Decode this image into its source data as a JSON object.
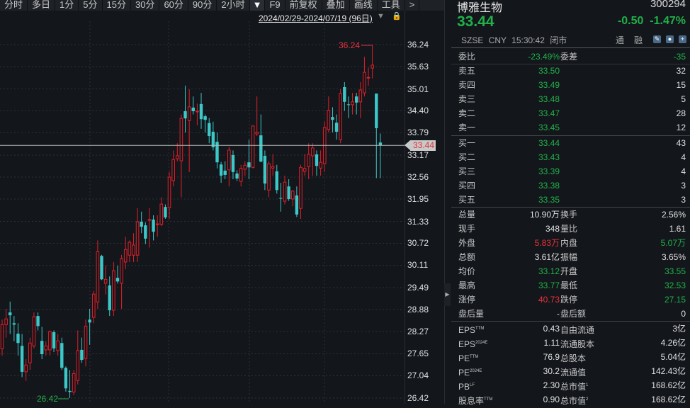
{
  "toolbar": {
    "items": [
      "分时",
      "多日",
      "1分",
      "5分",
      "15分",
      "30分",
      "60分",
      "90分",
      "2小时",
      "▼",
      "F9",
      "前复权",
      "叠加",
      "画线",
      "工具",
      ">"
    ]
  },
  "range": {
    "label": "2024/02/29-2024/07/19 (96日)"
  },
  "icons": {
    "range_dropdown": "triangle-down-icon",
    "lock": "lock-icon",
    "toggle": "chevron-right-icon"
  },
  "colors": {
    "up": "#e0202a",
    "down": "#3cc8c8",
    "green": "#22b04a",
    "red": "#e8323c",
    "bg": "#13161b"
  },
  "stock": {
    "name": "博雅生物",
    "code": "300294",
    "last": "33.44",
    "change": "-0.50",
    "change_pct": "-1.47%",
    "exchange": "SZSE",
    "currency": "CNY",
    "time": "15:30:42",
    "status": "闭市",
    "flag1": "通",
    "flag2": "融"
  },
  "weibi": {
    "label": "委比",
    "value": "-23.49%",
    "label2": "委差",
    "value2": "-35"
  },
  "asks": [
    {
      "label": "卖五",
      "price": "33.50",
      "vol": "32"
    },
    {
      "label": "卖四",
      "price": "33.49",
      "vol": "15"
    },
    {
      "label": "卖三",
      "price": "33.48",
      "vol": "5"
    },
    {
      "label": "卖二",
      "price": "33.47",
      "vol": "28"
    },
    {
      "label": "卖一",
      "price": "33.45",
      "vol": "12"
    }
  ],
  "bids": [
    {
      "label": "买一",
      "price": "33.44",
      "vol": "43"
    },
    {
      "label": "买二",
      "price": "33.43",
      "vol": "4"
    },
    {
      "label": "买三",
      "price": "33.39",
      "vol": "4"
    },
    {
      "label": "买四",
      "price": "33.38",
      "vol": "3"
    },
    {
      "label": "买五",
      "price": "33.35",
      "vol": "3"
    }
  ],
  "stats": [
    {
      "l": "总量",
      "v": "10.90万",
      "l2": "换手",
      "v2": "2.56%",
      "c1": "w",
      "c2": "w"
    },
    {
      "l": "现手",
      "v": "348",
      "l2": "量比",
      "v2": "1.61",
      "c1": "w",
      "c2": "w"
    },
    {
      "l": "外盘",
      "v": "5.83万",
      "l2": "内盘",
      "v2": "5.07万",
      "c1": "r",
      "c2": "g"
    },
    {
      "l": "总额",
      "v": "3.61亿",
      "l2": "振幅",
      "v2": "3.65%",
      "c1": "w",
      "c2": "w"
    },
    {
      "l": "均价",
      "v": "33.12",
      "l2": "开盘",
      "v2": "33.55",
      "c1": "g",
      "c2": "g"
    },
    {
      "l": "最高",
      "v": "33.77",
      "l2": "最低",
      "v2": "32.53",
      "c1": "g",
      "c2": "g"
    },
    {
      "l": "涨停",
      "v": "40.73",
      "l2": "跌停",
      "v2": "27.15",
      "c1": "r",
      "c2": "g"
    },
    {
      "l": "盘后量",
      "v": "-",
      "l2": "盘后额",
      "v2": "0",
      "c1": "w",
      "c2": "w"
    }
  ],
  "fundamentals": [
    {
      "l": "EPS",
      "sup": "TTM",
      "v": "0.43",
      "l2": "自由流通",
      "sup2": "",
      "v2": "3亿"
    },
    {
      "l": "EPS",
      "sup": "2024E",
      "v": "1.11",
      "l2": "流通股本",
      "sup2": "",
      "v2": "4.26亿"
    },
    {
      "l": "PE",
      "sup": "TTM",
      "v": "76.9",
      "l2": "总股本",
      "sup2": "",
      "v2": "5.04亿"
    },
    {
      "l": "PE",
      "sup": "2024E",
      "v": "30.2",
      "l2": "流通值",
      "sup2": "",
      "v2": "142.43亿"
    },
    {
      "l": "PB",
      "sup": "LF",
      "v": "2.30",
      "l2": "总市值",
      "sup2": "1",
      "v2": "168.62亿"
    },
    {
      "l": "股息率",
      "sup": "TTM",
      "v": "0.90",
      "l2": "总市值",
      "sup2": "2",
      "v2": "168.62亿"
    }
  ],
  "chart_data": {
    "type": "candlestick",
    "ylim": [
      26.42,
      36.24
    ],
    "yticks": [
      "36.24",
      "35.63",
      "35.01",
      "34.40",
      "33.79",
      "33.17",
      "32.56",
      "31.95",
      "31.33",
      "30.72",
      "30.11",
      "29.49",
      "28.88",
      "28.27",
      "27.65",
      "27.04",
      "26.42"
    ],
    "last_price": "33.44",
    "max_label": "36.24",
    "min_label": "26.42",
    "grid": true,
    "ohlc": [
      [
        27.79,
        28.46,
        28.6,
        27.6
      ],
      [
        28.46,
        28.62,
        28.9,
        28.1
      ],
      [
        28.8,
        28.72,
        29.1,
        28.2
      ],
      [
        28.5,
        28.46,
        28.7,
        28.0
      ],
      [
        28.21,
        27.95,
        28.5,
        27.6
      ],
      [
        27.87,
        27.15,
        28.2,
        27.0
      ],
      [
        27.15,
        27.34,
        27.5,
        26.9
      ],
      [
        27.4,
        27.95,
        28.1,
        27.2
      ],
      [
        27.87,
        28.68,
        28.8,
        27.8
      ],
      [
        28.7,
        28.42,
        28.8,
        28.3
      ],
      [
        28.01,
        27.64,
        28.4,
        27.5
      ],
      [
        27.76,
        27.87,
        28.0,
        27.6
      ],
      [
        27.76,
        28.27,
        28.3,
        27.6
      ],
      [
        28.25,
        27.8,
        28.3,
        27.7
      ],
      [
        27.74,
        28.01,
        28.2,
        27.6
      ],
      [
        27.95,
        27.26,
        28.1,
        27.2
      ],
      [
        27.26,
        26.69,
        27.3,
        26.6
      ],
      [
        26.62,
        26.59,
        27.2,
        26.42
      ],
      [
        26.59,
        27.1,
        27.2,
        26.5
      ],
      [
        26.91,
        27.74,
        28.3,
        26.8
      ],
      [
        27.76,
        27.48,
        28.1,
        27.4
      ],
      [
        27.52,
        28.42,
        28.6,
        27.3
      ],
      [
        28.6,
        28.52,
        28.9,
        27.9
      ],
      [
        28.66,
        29.31,
        29.4,
        28.5
      ],
      [
        29.09,
        30.49,
        30.8,
        28.9
      ],
      [
        30.37,
        29.72,
        30.4,
        29.7
      ],
      [
        29.61,
        29.72,
        30.1,
        29.3
      ],
      [
        29.55,
        28.86,
        29.8,
        28.7
      ],
      [
        28.86,
        29.96,
        30.2,
        28.7
      ],
      [
        29.76,
        29.66,
        30.1,
        29.6
      ],
      [
        29.61,
        30.29,
        30.4,
        28.9
      ],
      [
        30.2,
        30.55,
        30.9,
        30.0
      ],
      [
        30.39,
        30.75,
        30.8,
        30.2
      ],
      [
        30.39,
        30.67,
        31.0,
        30.2
      ],
      [
        30.39,
        31.32,
        31.7,
        30.2
      ],
      [
        31.32,
        31.18,
        31.6,
        31.0
      ],
      [
        31.22,
        30.85,
        31.3,
        30.7
      ],
      [
        31.36,
        31.38,
        31.7,
        30.6
      ],
      [
        31.38,
        31.04,
        31.5,
        30.8
      ],
      [
        31.24,
        31.26,
        31.5,
        30.9
      ],
      [
        31.24,
        31.81,
        32.0,
        31.2
      ],
      [
        31.73,
        31.44,
        31.8,
        31.4
      ],
      [
        31.71,
        32.56,
        32.7,
        31.4
      ],
      [
        32.46,
        33.05,
        33.3,
        32.3
      ],
      [
        33.07,
        33.15,
        33.5,
        33.0
      ],
      [
        33.01,
        34.19,
        34.3,
        32.0
      ],
      [
        34.39,
        34.19,
        35.1,
        33.8
      ],
      [
        34.13,
        34.51,
        35.0,
        32.7
      ],
      [
        34.49,
        34.39,
        34.8,
        34.3
      ],
      [
        34.37,
        34.39,
        34.6,
        34.0
      ],
      [
        34.59,
        34.17,
        34.9,
        33.9
      ],
      [
        34.25,
        34.15,
        34.3,
        33.8
      ],
      [
        34.06,
        33.7,
        34.2,
        33.5
      ],
      [
        33.82,
        33.39,
        34.1,
        33.3
      ],
      [
        33.54,
        32.97,
        33.8,
        32.8
      ],
      [
        32.91,
        32.6,
        32.98,
        32.4
      ],
      [
        32.74,
        32.62,
        33.0,
        32.5
      ],
      [
        32.76,
        33.31,
        33.4,
        32.3
      ],
      [
        33.17,
        32.7,
        33.3,
        32.5
      ],
      [
        32.66,
        32.52,
        32.75,
        32.45
      ],
      [
        32.44,
        32.8,
        32.9,
        32.3
      ],
      [
        32.78,
        32.89,
        33.0,
        32.6
      ],
      [
        32.97,
        32.83,
        33.6,
        32.5
      ],
      [
        32.83,
        33.98,
        34.0,
        32.8
      ],
      [
        33.76,
        33.8,
        34.8,
        33.7
      ],
      [
        33.72,
        32.99,
        34.3,
        32.97
      ],
      [
        33.15,
        32.38,
        33.3,
        32.2
      ],
      [
        32.2,
        32.93,
        33.0,
        32.0
      ],
      [
        32.81,
        32.85,
        33.2,
        32.6
      ],
      [
        32.72,
        32.2,
        32.9,
        32.1
      ],
      [
        31.98,
        31.97,
        32.4,
        31.6
      ],
      [
        31.89,
        32.42,
        32.6,
        31.8
      ],
      [
        32.3,
        31.95,
        32.5,
        31.9
      ],
      [
        31.95,
        32.17,
        32.2,
        31.75
      ],
      [
        32.05,
        31.52,
        32.3,
        31.45
      ],
      [
        31.69,
        32.83,
        32.9,
        31.4
      ],
      [
        32.72,
        32.8,
        33.2,
        32.6
      ],
      [
        32.85,
        33.19,
        33.5,
        32.5
      ],
      [
        33.15,
        33.37,
        33.5,
        32.6
      ],
      [
        33.19,
        32.87,
        33.3,
        32.6
      ],
      [
        32.81,
        32.97,
        33.3,
        32.6
      ],
      [
        32.93,
        33.94,
        34.1,
        32.7
      ],
      [
        33.88,
        34.41,
        34.8,
        33.8
      ],
      [
        34.23,
        34.15,
        34.5,
        33.8
      ],
      [
        34.07,
        33.82,
        34.3,
        33.6
      ],
      [
        33.6,
        34.88,
        35.0,
        33.5
      ],
      [
        35.06,
        34.65,
        35.2,
        34.4
      ],
      [
        34.58,
        34.57,
        34.8,
        34.2
      ],
      [
        34.57,
        34.65,
        34.9,
        34.3
      ],
      [
        34.8,
        34.63,
        34.9,
        34.3
      ],
      [
        34.65,
        34.98,
        35.2,
        34.2
      ],
      [
        34.9,
        35.47,
        35.9,
        34.8
      ],
      [
        35.31,
        35.33,
        35.6,
        35.1
      ],
      [
        35.59,
        35.67,
        36.24,
        35.3
      ],
      [
        34.88,
        33.92,
        34.88,
        32.53
      ],
      [
        33.52,
        33.44,
        33.77,
        32.53
      ]
    ]
  }
}
